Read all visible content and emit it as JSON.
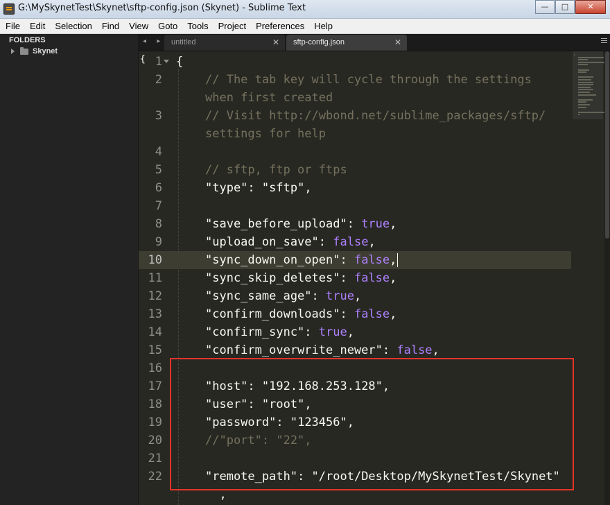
{
  "window": {
    "title": "G:\\MySkynetTest\\Skynet\\sftp-config.json (Skynet) - Sublime Text",
    "minimize": "—",
    "maximize": "□",
    "close": "✕"
  },
  "menu": [
    "File",
    "Edit",
    "Selection",
    "Find",
    "View",
    "Goto",
    "Tools",
    "Project",
    "Preferences",
    "Help"
  ],
  "sidebar": {
    "header": "FOLDERS",
    "folder": "Skynet"
  },
  "tabs": {
    "nav": "◂ ▸",
    "items": [
      {
        "label": "untitled",
        "close": "✕"
      },
      {
        "label": "sftp-config.json",
        "close": "✕"
      }
    ]
  },
  "editor": {
    "fold_marker": "{",
    "active_line": 10,
    "lines": [
      {
        "n": "1",
        "parts": [
          {
            "t": "{",
            "c": "punc"
          }
        ]
      },
      {
        "n": "2",
        "parts": [
          {
            "t": "// The tab key will cycle through the settings",
            "c": "cmt"
          }
        ]
      },
      {
        "n": "",
        "parts": [
          {
            "t": "when first created",
            "c": "cmt"
          }
        ]
      },
      {
        "n": "3",
        "parts": [
          {
            "t": "// Visit http://wbond.net/sublime_packages/sftp/",
            "c": "cmt"
          }
        ]
      },
      {
        "n": "",
        "parts": [
          {
            "t": "settings for help",
            "c": "cmt"
          }
        ]
      },
      {
        "n": "4",
        "parts": []
      },
      {
        "n": "5",
        "parts": [
          {
            "t": "// sftp, ftp or ftps",
            "c": "cmt"
          }
        ]
      },
      {
        "n": "6",
        "parts": [
          {
            "t": "\"type\"",
            "c": "key"
          },
          {
            "t": ": ",
            "c": "punc"
          },
          {
            "t": "\"sftp\"",
            "c": "key"
          },
          {
            "t": ",",
            "c": "punc"
          }
        ]
      },
      {
        "n": "7",
        "parts": []
      },
      {
        "n": "8",
        "parts": [
          {
            "t": "\"save_before_upload\"",
            "c": "key"
          },
          {
            "t": ": ",
            "c": "punc"
          },
          {
            "t": "true",
            "c": "bool"
          },
          {
            "t": ",",
            "c": "punc"
          }
        ]
      },
      {
        "n": "9",
        "parts": [
          {
            "t": "\"upload_on_save\"",
            "c": "key"
          },
          {
            "t": ": ",
            "c": "punc"
          },
          {
            "t": "false",
            "c": "bool"
          },
          {
            "t": ",",
            "c": "punc"
          }
        ]
      },
      {
        "n": "10",
        "parts": [
          {
            "t": "\"sync_down_on_open\"",
            "c": "key"
          },
          {
            "t": ": ",
            "c": "punc"
          },
          {
            "t": "false",
            "c": "bool"
          },
          {
            "t": ",",
            "c": "punc"
          }
        ]
      },
      {
        "n": "11",
        "parts": [
          {
            "t": "\"sync_skip_deletes\"",
            "c": "key"
          },
          {
            "t": ": ",
            "c": "punc"
          },
          {
            "t": "false",
            "c": "bool"
          },
          {
            "t": ",",
            "c": "punc"
          }
        ]
      },
      {
        "n": "12",
        "parts": [
          {
            "t": "\"sync_same_age\"",
            "c": "key"
          },
          {
            "t": ": ",
            "c": "punc"
          },
          {
            "t": "true",
            "c": "bool"
          },
          {
            "t": ",",
            "c": "punc"
          }
        ]
      },
      {
        "n": "13",
        "parts": [
          {
            "t": "\"confirm_downloads\"",
            "c": "key"
          },
          {
            "t": ": ",
            "c": "punc"
          },
          {
            "t": "false",
            "c": "bool"
          },
          {
            "t": ",",
            "c": "punc"
          }
        ]
      },
      {
        "n": "14",
        "parts": [
          {
            "t": "\"confirm_sync\"",
            "c": "key"
          },
          {
            "t": ": ",
            "c": "punc"
          },
          {
            "t": "true",
            "c": "bool"
          },
          {
            "t": ",",
            "c": "punc"
          }
        ]
      },
      {
        "n": "15",
        "parts": [
          {
            "t": "\"confirm_overwrite_newer\"",
            "c": "key"
          },
          {
            "t": ": ",
            "c": "punc"
          },
          {
            "t": "false",
            "c": "bool"
          },
          {
            "t": ",",
            "c": "punc"
          }
        ]
      },
      {
        "n": "16",
        "parts": []
      },
      {
        "n": "17",
        "parts": [
          {
            "t": "\"host\"",
            "c": "key"
          },
          {
            "t": ": ",
            "c": "punc"
          },
          {
            "t": "\"192.168.253.128\"",
            "c": "key"
          },
          {
            "t": ",",
            "c": "punc"
          }
        ]
      },
      {
        "n": "18",
        "parts": [
          {
            "t": "\"user\"",
            "c": "key"
          },
          {
            "t": ": ",
            "c": "punc"
          },
          {
            "t": "\"root\"",
            "c": "key"
          },
          {
            "t": ",",
            "c": "punc"
          }
        ]
      },
      {
        "n": "19",
        "parts": [
          {
            "t": "\"password\"",
            "c": "key"
          },
          {
            "t": ": ",
            "c": "punc"
          },
          {
            "t": "\"123456\"",
            "c": "key"
          },
          {
            "t": ",",
            "c": "punc"
          }
        ]
      },
      {
        "n": "20",
        "parts": [
          {
            "t": "//\"port\": \"22\",",
            "c": "cmt"
          }
        ]
      },
      {
        "n": "21",
        "parts": []
      },
      {
        "n": "22",
        "parts": [
          {
            "t": "\"remote_path\"",
            "c": "key"
          },
          {
            "t": ": ",
            "c": "punc"
          },
          {
            "t": "\"/root/Desktop/MySkynetTest/Skynet\"",
            "c": "key"
          }
        ]
      },
      {
        "n": "",
        "parts": [
          {
            "t": "  ,",
            "c": "punc"
          }
        ]
      }
    ]
  },
  "colors": {
    "background": "#272822",
    "comment": "#75715e",
    "boolean": "#ae81ff",
    "text": "#f8f8f2",
    "annotation_box": "#e63329"
  }
}
